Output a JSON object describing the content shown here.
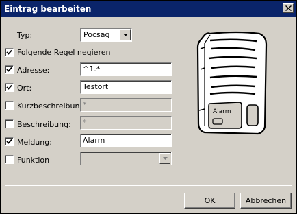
{
  "window": {
    "title": "Eintrag bearbeiten"
  },
  "form": {
    "typ": {
      "label": "Typ:",
      "value": "Pocsag"
    },
    "negate": {
      "label": "Folgende Regel negieren",
      "checked": true
    },
    "adresse": {
      "label": "Adresse:",
      "checked": true,
      "value": "^1.*"
    },
    "ort": {
      "label": "Ort:",
      "checked": true,
      "value": "Testort"
    },
    "kurzbeschreibung": {
      "label": "Kurzbeschreibung:",
      "checked": false,
      "value": "*"
    },
    "beschreibung": {
      "label": "Beschreibung:",
      "checked": false,
      "value": "*"
    },
    "meldung": {
      "label": "Meldung:",
      "checked": true,
      "value": "Alarm"
    },
    "funktion": {
      "label": "Funktion",
      "checked": false,
      "value": ""
    }
  },
  "pager": {
    "screen_text": "Alarm"
  },
  "buttons": {
    "ok": "OK",
    "cancel": "Abbrechen"
  },
  "colors": {
    "titlebar": "#0a246a",
    "face": "#d4d0c8"
  }
}
